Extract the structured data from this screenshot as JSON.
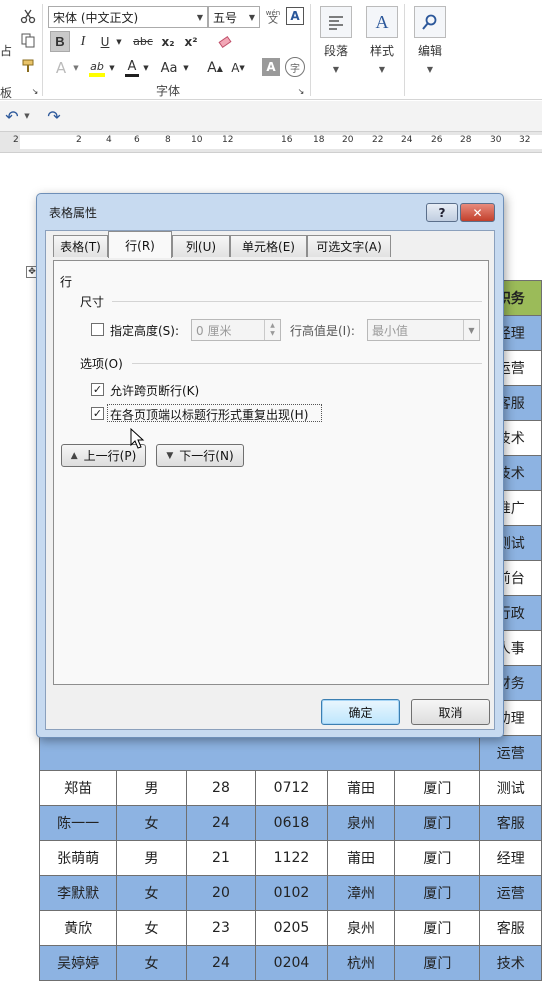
{
  "ribbon": {
    "font_name": "宋体 (中文正文)",
    "font_size": "五号",
    "wen_label": "wén",
    "font_group_label": "字体",
    "clipboard_label_fragment": "板",
    "paste_fragment": "占",
    "paragraph_label": "段落",
    "styles_label": "样式",
    "editing_label": "编辑",
    "bold": "B",
    "italic": "I",
    "underline": "U",
    "strike": "abc",
    "subscript": "x₂",
    "superscript": "x²",
    "text_effects": "A",
    "highlight": "ab",
    "font_color": "A",
    "change_case": "Aa",
    "grow": "A",
    "shrink": "A",
    "char_shading": "A",
    "enclose": "字",
    "char_border": "A"
  },
  "ruler": {
    "ticks": [
      "2",
      "2",
      "4",
      "6",
      "8",
      "10",
      "12",
      "16",
      "18",
      "20",
      "22",
      "24",
      "26",
      "28",
      "30",
      "32"
    ]
  },
  "dialog": {
    "title": "表格属性",
    "help": "?",
    "close": "✕",
    "tabs": [
      "表格(T)",
      "行(R)",
      "列(U)",
      "单元格(E)",
      "可选文字(A)"
    ],
    "row_heading": "行",
    "size_section": "尺寸",
    "specify_height_label": "指定高度(S):",
    "height_value": "0 厘米",
    "row_height_is_label": "行高值是(I):",
    "row_height_mode": "最小值",
    "options_section": "选项(O)",
    "allow_break_label": "允许跨页断行(K)",
    "allow_break_checked": true,
    "repeat_header_label": "在各页顶端以标题行形式重复出现(H)",
    "repeat_header_checked": true,
    "prev_row": "上一行(P)",
    "next_row": "下一行(N)",
    "ok": "确定",
    "cancel": "取消"
  },
  "table": {
    "header_fragment": "职务",
    "right_fragments": [
      "经理",
      "运营",
      "客服",
      "技术",
      "技术",
      "推广",
      "测试",
      "前台",
      "行政",
      "人事",
      "财务",
      "助理",
      "运营"
    ],
    "rows": [
      {
        "name": "郑苗",
        "gender": "男",
        "age": "28",
        "code": "0712",
        "origin": "莆田",
        "city": "厦门",
        "role": "测试",
        "color": "white"
      },
      {
        "name": "陈一一",
        "gender": "女",
        "age": "24",
        "code": "0618",
        "origin": "泉州",
        "city": "厦门",
        "role": "客服",
        "color": "blue"
      },
      {
        "name": "张萌萌",
        "gender": "男",
        "age": "21",
        "code": "1122",
        "origin": "莆田",
        "city": "厦门",
        "role": "经理",
        "color": "white"
      },
      {
        "name": "李默默",
        "gender": "女",
        "age": "20",
        "code": "0102",
        "origin": "漳州",
        "city": "厦门",
        "role": "运营",
        "color": "blue"
      },
      {
        "name": "黄欣",
        "gender": "女",
        "age": "23",
        "code": "0205",
        "origin": "泉州",
        "city": "厦门",
        "role": "客服",
        "color": "white"
      },
      {
        "name": "吴婷婷",
        "gender": "女",
        "age": "24",
        "code": "0204",
        "origin": "杭州",
        "city": "厦门",
        "role": "技术",
        "color": "blue"
      }
    ]
  },
  "colors": {
    "header_green": "#9bbb59",
    "row_blue": "#8db3e2",
    "dialog_frame": "#c7daf0"
  }
}
